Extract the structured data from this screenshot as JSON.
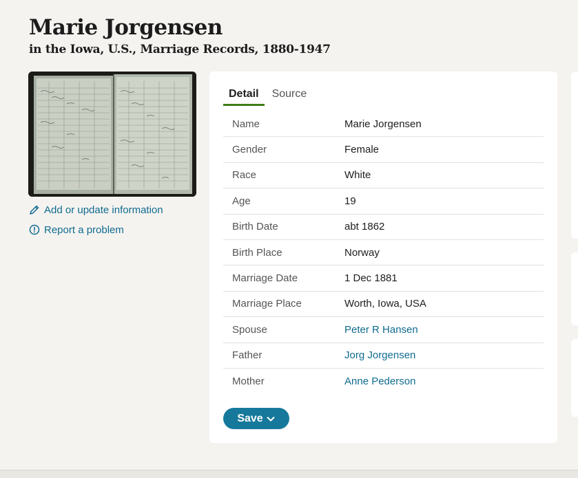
{
  "record": {
    "name": "Marie Jorgensen",
    "collection": "in the Iowa, U.S., Marriage Records, 1880-1947"
  },
  "thumbnail": {
    "icon": "record-book-image"
  },
  "side_links": [
    {
      "label": "Add or update information",
      "icon": "pencil-icon"
    },
    {
      "label": "Report a problem",
      "icon": "alert-circle-icon"
    }
  ],
  "tabs": [
    {
      "label": "Detail",
      "active": true
    },
    {
      "label": "Source",
      "active": false
    }
  ],
  "details": [
    {
      "label": "Name",
      "value": "Marie Jorgensen",
      "link": false
    },
    {
      "label": "Gender",
      "value": "Female",
      "link": false
    },
    {
      "label": "Race",
      "value": "White",
      "link": false
    },
    {
      "label": "Age",
      "value": "19",
      "link": false
    },
    {
      "label": "Birth Date",
      "value": "abt 1862",
      "link": false
    },
    {
      "label": "Birth Place",
      "value": "Norway",
      "link": false
    },
    {
      "label": "Marriage Date",
      "value": "1 Dec 1881",
      "link": false
    },
    {
      "label": "Marriage Place",
      "value": "Worth, Iowa, USA",
      "link": false
    },
    {
      "label": "Spouse",
      "value": "Peter R Hansen",
      "link": true
    },
    {
      "label": "Father",
      "value": "Jorg Jorgensen",
      "link": true
    },
    {
      "label": "Mother",
      "value": "Anne Pederson",
      "link": true
    }
  ],
  "save": {
    "label": "Save",
    "icon": "chevron-down-icon"
  },
  "colors": {
    "accent": "#16799b",
    "link": "#0f6b8e",
    "tab_underline": "#3e7c17",
    "background": "#f5f3f0"
  }
}
